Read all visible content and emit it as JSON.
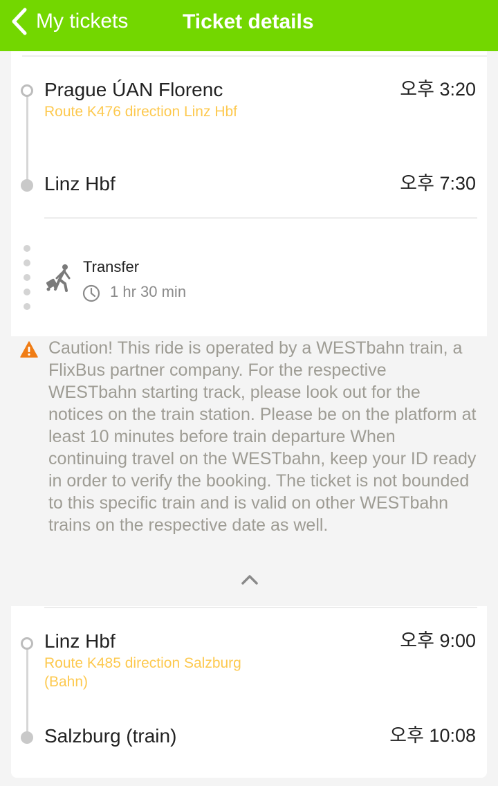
{
  "nav": {
    "back_label": "My tickets",
    "title": "Ticket details"
  },
  "segments": [
    {
      "from": {
        "name": "Prague ÚAN Florenc",
        "time": "오후 3:20"
      },
      "route": "Route K476 direction Linz Hbf",
      "to": {
        "name": "Linz Hbf",
        "time": "오후 7:30"
      }
    },
    {
      "from": {
        "name": "Linz Hbf",
        "time": "오후 9:00"
      },
      "route": "Route K485 direction Salzburg (Bahn)",
      "to": {
        "name": "Salzburg (train)",
        "time": "오후 10:08"
      }
    }
  ],
  "transfer": {
    "title": "Transfer",
    "duration": "1 hr 30 min"
  },
  "caution": {
    "text": "Caution! This ride is operated by a WESTbahn train, a FlixBus partner company. For the respective WESTbahn starting track, please look out for the notices on the train station. Please be on the platform at least 10 minutes before train departure When continuing travel on the WESTbahn, keep your ID ready in order to verify the booking. The ticket is not bounded to this specific train and is valid on other WESTbahn trains on the respective date as well."
  },
  "colors": {
    "brand": "#73d700",
    "route": "#fdc94f",
    "warning": "#f07c14"
  },
  "icons": {
    "back": "chevron-left-icon",
    "transfer": "walking-luggage-icon",
    "clock": "clock-icon",
    "warning": "warning-triangle-icon",
    "collapse": "chevron-up-icon"
  }
}
